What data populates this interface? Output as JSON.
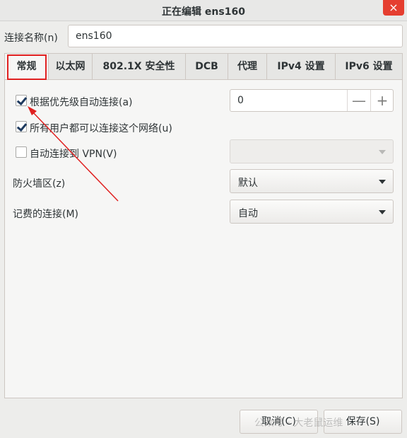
{
  "window": {
    "title": "正在编辑 ens160",
    "close_symbol": "×"
  },
  "connection_name": {
    "label": "连接名称(n)",
    "value": "ens160"
  },
  "tabs": [
    {
      "label": "常规",
      "active": true
    },
    {
      "label": "以太网"
    },
    {
      "label": "802.1X 安全性"
    },
    {
      "label": "DCB"
    },
    {
      "label": "代理"
    },
    {
      "label": "IPv4 设置"
    },
    {
      "label": "IPv6 设置"
    }
  ],
  "general": {
    "auto_connect": {
      "label": "根据优先级自动连接(a)",
      "checked": true
    },
    "priority": {
      "value": "0",
      "minus": "—",
      "plus": "+"
    },
    "all_users": {
      "label": "所有用户都可以连接这个网络(u)",
      "checked": true
    },
    "auto_vpn": {
      "label": "自动连接到 VPN(V)",
      "checked": false
    },
    "vpn_select": {
      "value": ""
    },
    "firewall_zone": {
      "label": "防火墙区(z)",
      "value": "默认"
    },
    "metered": {
      "label": "记费的连接(M)",
      "value": "自动"
    }
  },
  "buttons": {
    "cancel": "取消(C)",
    "save": "保存(S)"
  },
  "watermark": "公众号 · 大老鼠运维",
  "colors": {
    "highlight": "#e02020",
    "close": "#e53e30"
  }
}
